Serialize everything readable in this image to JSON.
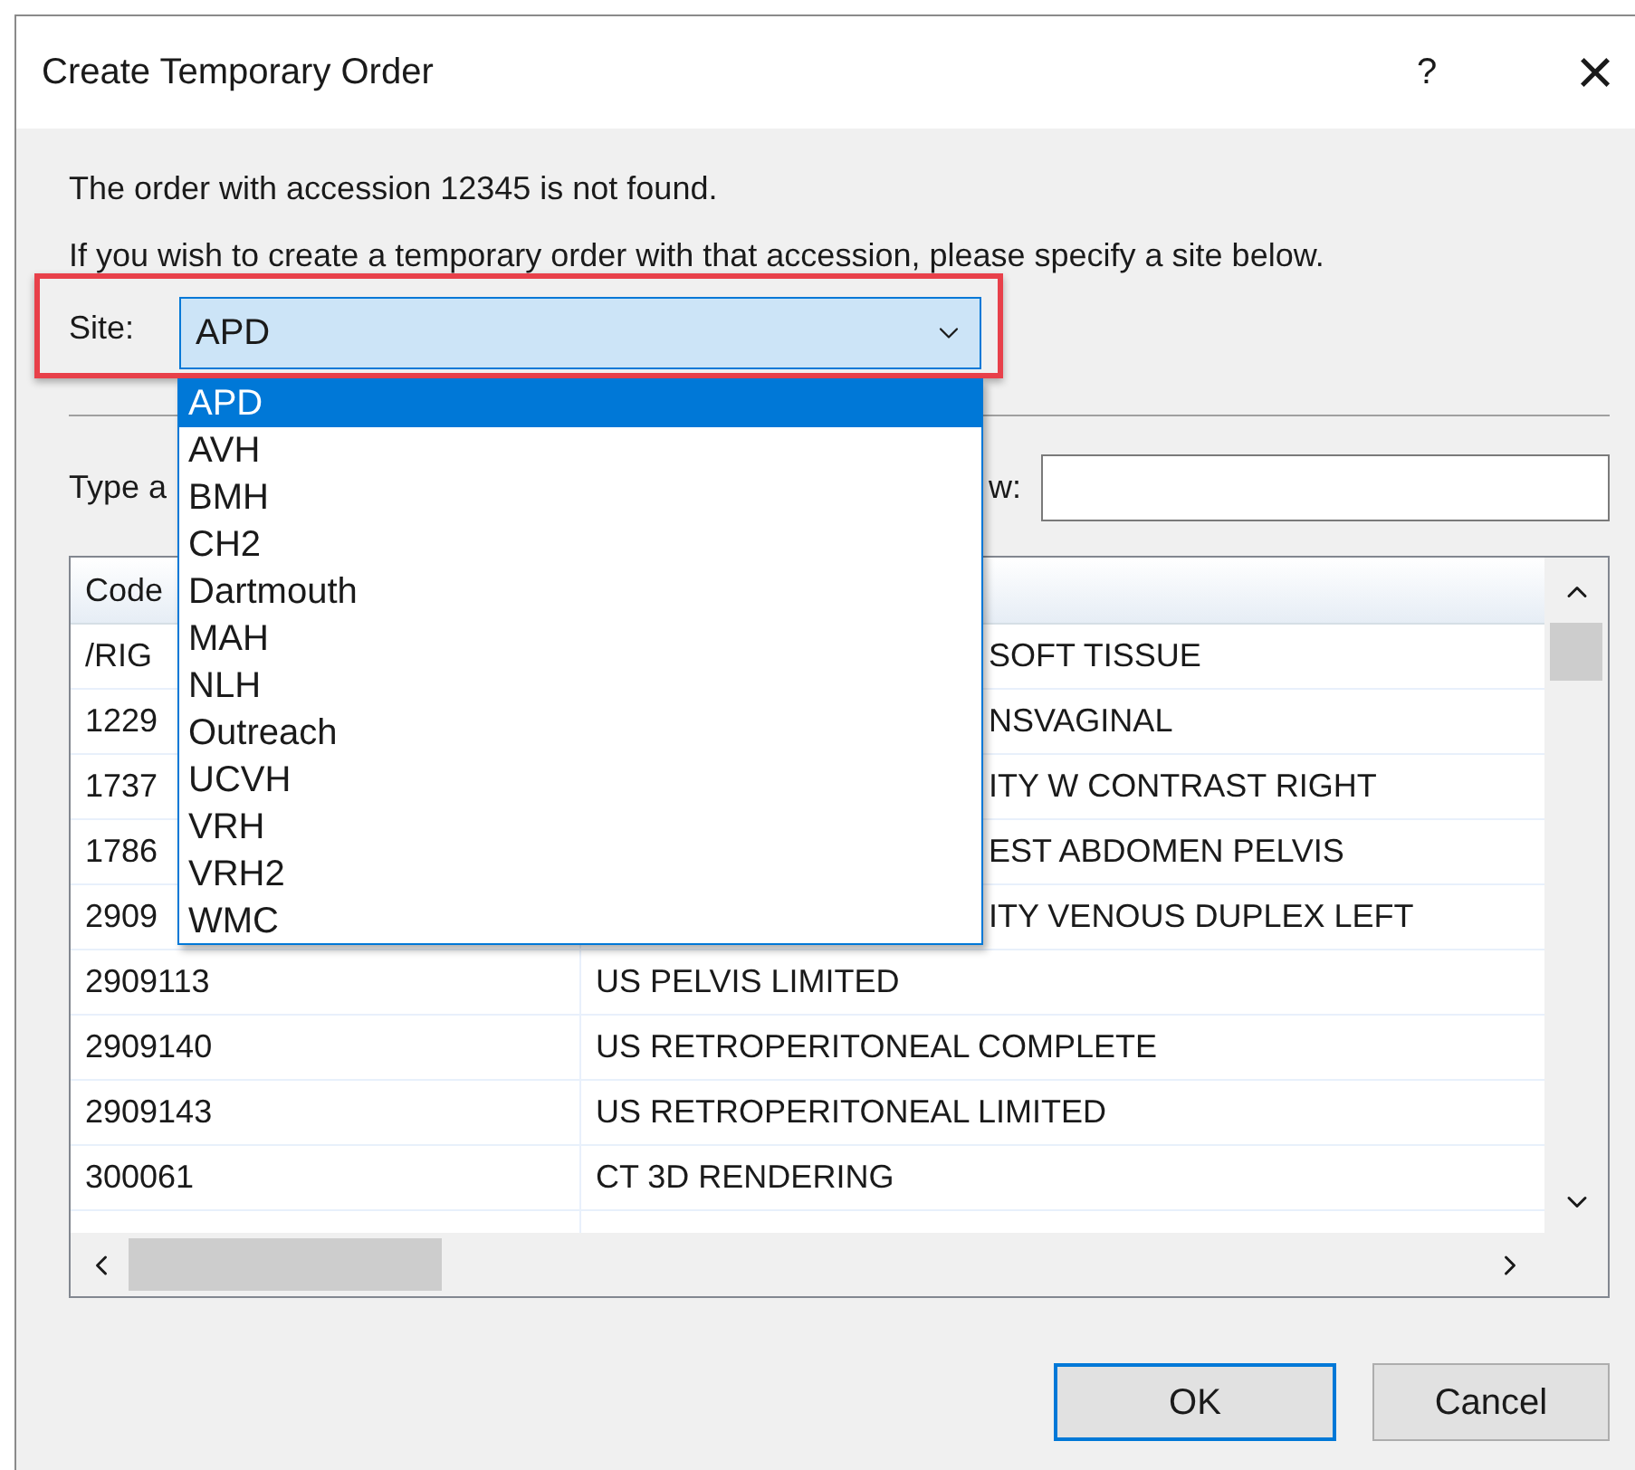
{
  "window": {
    "title": "Create Temporary Order",
    "help": "?",
    "close": "×"
  },
  "messages": [
    "The order with accession 12345 is not found.",
    "If you wish to create a temporary order with that accession, please specify a site below."
  ],
  "site": {
    "label": "Site:",
    "value": "APD",
    "expanded": true,
    "highlighted": true,
    "options": [
      {
        "label": "APD",
        "selected": true
      },
      {
        "label": "AVH",
        "selected": false
      },
      {
        "label": "BMH",
        "selected": false
      },
      {
        "label": "CH2",
        "selected": false
      },
      {
        "label": "Dartmouth",
        "selected": false
      },
      {
        "label": "MAH",
        "selected": false
      },
      {
        "label": "NLH",
        "selected": false
      },
      {
        "label": "Outreach",
        "selected": false
      },
      {
        "label": "UCVH",
        "selected": false
      },
      {
        "label": "VRH",
        "selected": false
      },
      {
        "label": "VRH2",
        "selected": false
      },
      {
        "label": "WMC",
        "selected": false
      }
    ]
  },
  "filter": {
    "label_start": "Type a",
    "label_end": "w:"
  },
  "table": {
    "columns": [
      "Code"
    ],
    "rows": [
      {
        "code": "/RIG",
        "description": "SOFT TISSUE",
        "covered": true
      },
      {
        "code": "1229",
        "description": "NSVAGINAL",
        "covered": true
      },
      {
        "code": "1737",
        "description": "ITY W CONTRAST RIGHT",
        "covered": true
      },
      {
        "code": "1786",
        "description": "EST ABDOMEN PELVIS",
        "covered": true
      },
      {
        "code": "2909",
        "description": "ITY VENOUS DUPLEX LEFT",
        "covered": true
      },
      {
        "code": "2909113",
        "description": "US PELVIS LIMITED",
        "covered": false
      },
      {
        "code": "2909140",
        "description": "US RETROPERITONEAL COMPLETE",
        "covered": false
      },
      {
        "code": "2909143",
        "description": "US RETROPERITONEAL LIMITED",
        "covered": false
      },
      {
        "code": "300061",
        "description": "CT 3D RENDERING",
        "covered": false
      }
    ]
  },
  "buttons": [
    {
      "label": "OK",
      "default": true
    },
    {
      "label": "Cancel",
      "default": false
    }
  ]
}
